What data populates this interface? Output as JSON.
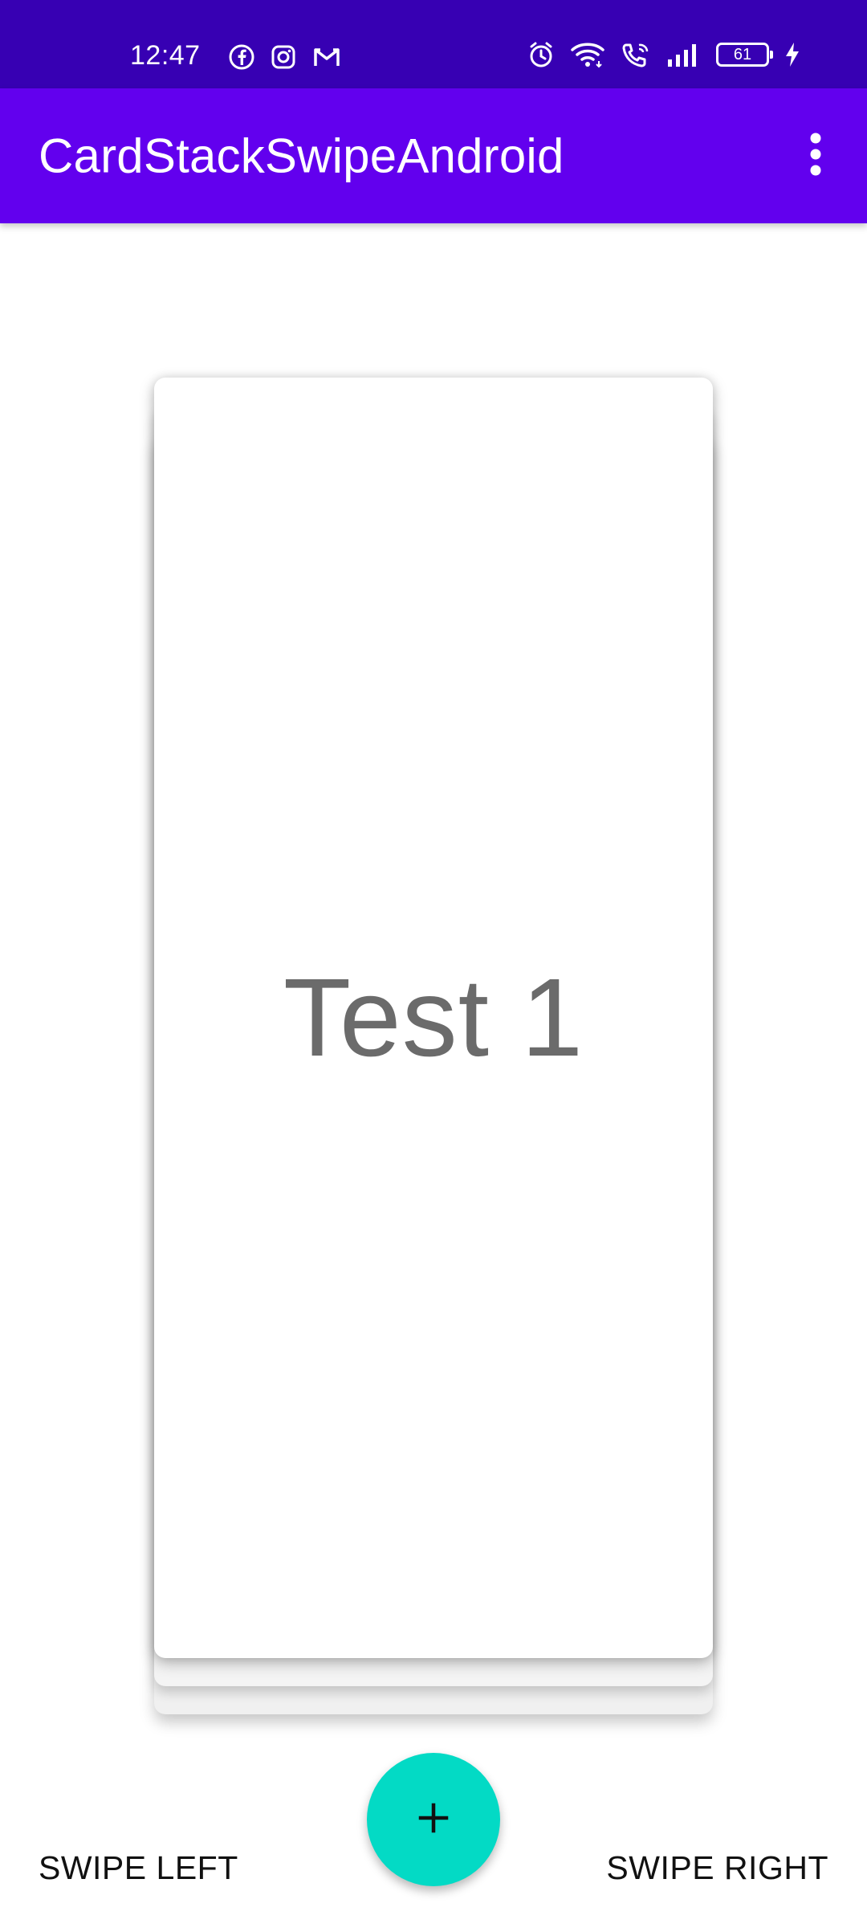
{
  "status_bar": {
    "time": "12:47",
    "notification_icons": [
      "facebook-icon",
      "instagram-icon",
      "gmail-icon"
    ],
    "system_icons": [
      "alarm-icon",
      "wifi-icon",
      "wifi-call-icon",
      "signal-icon",
      "battery-icon",
      "charging-icon"
    ],
    "battery_level": "61"
  },
  "app_bar": {
    "title": "CardStackSwipeAndroid",
    "overflow_icon": "more-vert-icon"
  },
  "card_stack": {
    "top_card_text": "Test 1",
    "stacked_cards_visible": 3
  },
  "controls": {
    "swipe_left_label": "SWIPE LEFT",
    "swipe_right_label": "SWIPE RIGHT",
    "fab_icon": "add-icon"
  },
  "colors": {
    "status_bar": "#3700B3",
    "app_bar": "#6200EE",
    "fab": "#03DAC5",
    "card_text": "#6B6B6B"
  }
}
